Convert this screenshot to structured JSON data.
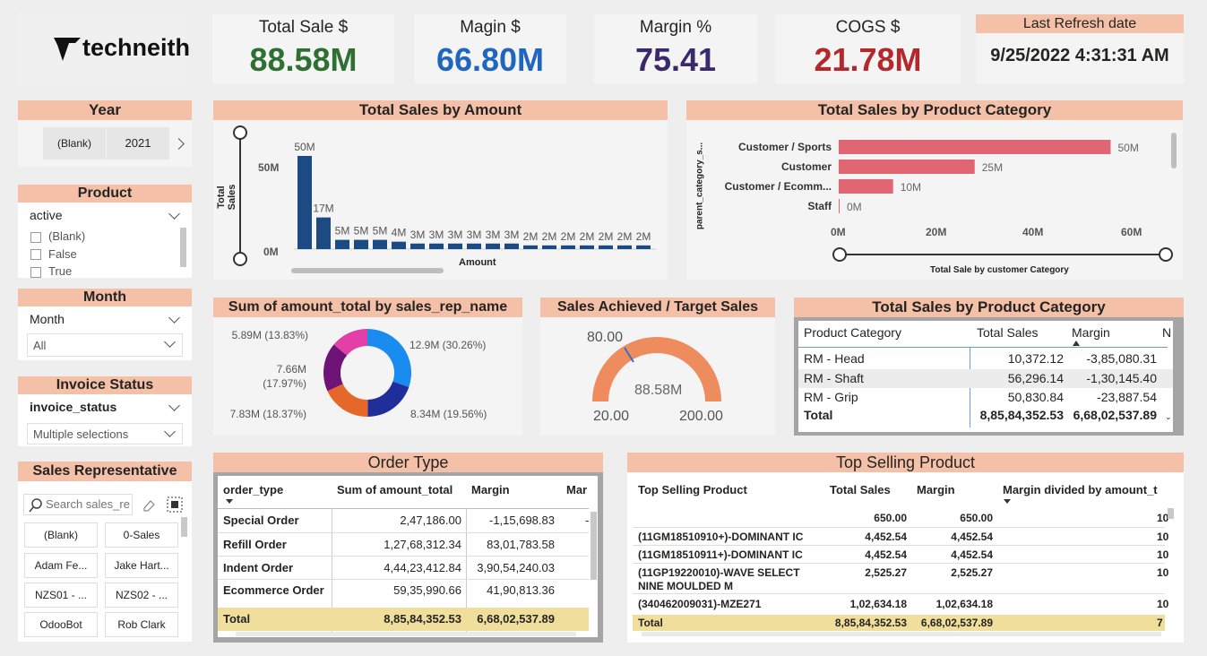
{
  "brand": {
    "name": "techneith"
  },
  "kpis": [
    {
      "title": "Total Sale $",
      "value": "88.58M",
      "color": "#2e7031"
    },
    {
      "title": "Magin $",
      "value": "66.80M",
      "color": "#1f66c1"
    },
    {
      "title": "Margin %",
      "value": "75.41",
      "color": "#3b2a6b"
    },
    {
      "title": "COGS $",
      "value": "21.78M",
      "color": "#b3282d"
    }
  ],
  "refresh": {
    "title": "Last Refresh date",
    "value": "9/25/2022 4:31:31 AM"
  },
  "filters": {
    "year": {
      "title": "Year",
      "options": [
        "(Blank)",
        "2021"
      ]
    },
    "product": {
      "title": "Product",
      "field": "active",
      "options": [
        "(Blank)",
        "False",
        "True"
      ]
    },
    "month": {
      "title": "Month",
      "field": "Month",
      "value": "All"
    },
    "invoice": {
      "title": "Invoice Status",
      "field": "invoice_status",
      "value": "Multiple selections"
    },
    "sales_rep": {
      "title": "Sales Representative",
      "placeholder": "Search sales_re",
      "options": [
        "(Blank)",
        "0-Sales",
        "Adam Fe...",
        "Jake Hart...",
        "NZS01 - ...",
        "NZS02 - ...",
        "OdooBot",
        "Rob Clark"
      ]
    }
  },
  "bar_chart": {
    "title": "Total Sales by Amount",
    "ylabel": "Total Sales",
    "xlabel": "Amount",
    "yticks": [
      "50M",
      "0M"
    ]
  },
  "hbar_chart": {
    "title": "Total Sales by Product Category",
    "ylabel": "parent_category_s...",
    "xlabel": "Total Sale by customer Category",
    "xticks": [
      "0M",
      "20M",
      "40M",
      "60M"
    ]
  },
  "donut_chart": {
    "title": "Sum of amount_total by sales_rep_name"
  },
  "gauge": {
    "title": "Sales Achieved / Target Sales",
    "value": "88.58M",
    "min": "20.00",
    "max": "200.00",
    "target": "80.00"
  },
  "chart_data": [
    {
      "type": "bar",
      "title": "Total Sales by Amount",
      "xlabel": "Amount",
      "ylabel": "Total Sales",
      "ylim": [
        0,
        60
      ],
      "values": [
        50,
        17,
        5,
        5,
        5,
        4,
        3,
        3,
        3,
        3,
        3,
        3,
        2,
        2,
        2,
        2,
        2,
        2,
        2
      ],
      "data_labels": [
        "50M",
        "17M",
        "5M",
        "5M",
        "5M",
        "4M",
        "3M",
        "3M",
        "3M",
        "3M",
        "3M",
        "3M",
        "2M",
        "2M",
        "2M",
        "2M",
        "2M",
        "2M",
        "2M"
      ],
      "color": "#1c4a82"
    },
    {
      "type": "bar",
      "orientation": "horizontal",
      "title": "Total Sales by Product Category",
      "xlabel": "Total Sale by customer Category",
      "ylabel": "parent_category_s...",
      "categories": [
        "Customer / Sports",
        "Customer",
        "Customer / Ecomm...",
        "Staff"
      ],
      "values": [
        50,
        25,
        10,
        0
      ],
      "data_labels": [
        "50M",
        "25M",
        "10M",
        "0M"
      ],
      "xlim": [
        0,
        68
      ],
      "color": "#e06674"
    },
    {
      "type": "pie",
      "title": "Sum of amount_total by sales_rep_name",
      "labels": [
        "12.9M (30.26%)",
        "8.34M (19.56%)",
        "7.83M (18.37%)",
        "7.66M (17.97%)",
        "5.89M (13.83%)"
      ],
      "values": [
        30.26,
        19.56,
        18.37,
        17.97,
        13.83
      ],
      "colors": [
        "#1a8cf0",
        "#1f2e9a",
        "#e6672a",
        "#6d1476",
        "#e33fa8"
      ]
    }
  ],
  "order_table": {
    "title": "Order Type",
    "columns": [
      "order_type",
      "Sum of amount_total",
      "Margin",
      "Mar"
    ],
    "rows": [
      [
        "Special Order",
        "2,47,186.00",
        "-1,15,698.83",
        "-"
      ],
      [
        "Refill Order",
        "1,27,68,312.34",
        "83,01,783.58",
        ""
      ],
      [
        "Indent Order",
        "4,44,23,412.84",
        "3,90,54,240.03",
        ""
      ],
      [
        "Ecommerce Order",
        "59,35,990.66",
        "41,90,813.36",
        ""
      ]
    ],
    "total": [
      "Total",
      "8,85,84,352.53",
      "6,68,02,537.89"
    ]
  },
  "category_table": {
    "title": "Total Sales by Product Category",
    "columns": [
      "Product Category",
      "Total Sales",
      "Margin",
      "N"
    ],
    "rows": [
      [
        "RM - Head",
        "10,372.12",
        "-3,85,080.31"
      ],
      [
        "RM - Shaft",
        "56,296.14",
        "-1,30,145.40"
      ],
      [
        "RM - Grip",
        "50,830.84",
        "-23,887.54"
      ]
    ],
    "total": [
      "Total",
      "8,85,84,352.53",
      "6,68,02,537.89"
    ]
  },
  "top_table": {
    "title": "Top Selling Product",
    "columns": [
      "Top Selling Product",
      "Total Sales",
      "Margin",
      "Margin divided by amount_t"
    ],
    "rows": [
      [
        "",
        "650.00",
        "650.00",
        "10"
      ],
      [
        "(11GM18510910+)-DOMINANT IC",
        "4,452.54",
        "4,452.54",
        "10"
      ],
      [
        "(11GM18510911+)-DOMINANT IC",
        "4,452.54",
        "4,452.54",
        "10"
      ],
      [
        "(11GP19220010)-WAVE SELECT",
        "2,525.27",
        "2,525.27",
        "10"
      ],
      [
        "NINE MOULDED M",
        "",
        "",
        ""
      ],
      [
        "(340462009031)-MZE271",
        "1,02,634.18",
        "1,02,634.18",
        "10"
      ]
    ],
    "total": [
      "Total",
      "8,85,84,352.53",
      "6,68,02,537.89",
      "7"
    ]
  }
}
